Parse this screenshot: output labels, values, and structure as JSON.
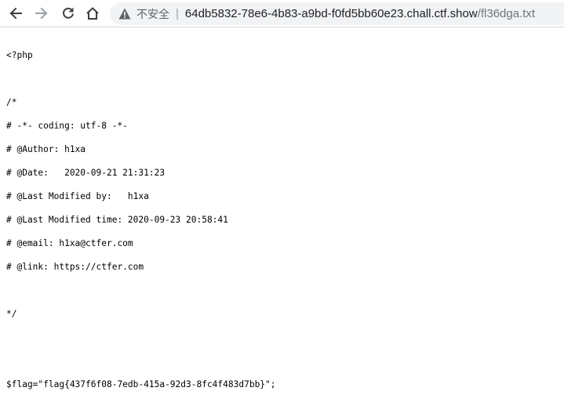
{
  "toolbar": {
    "back_icon": "arrow-left-icon",
    "forward_icon": "arrow-right-icon",
    "reload_icon": "reload-icon",
    "home_icon": "home-icon",
    "security_icon": "warning-triangle-icon",
    "security_label": "不安全",
    "url_host": "64db5832-78e6-4b83-a9bd-f0fd5bb60e23.chall.ctf.show",
    "url_path": "/fl36dga.txt"
  },
  "file": {
    "lines": [
      "<?php",
      "",
      "/*",
      "# -*- coding: utf-8 -*-",
      "# @Author: h1xa",
      "# @Date:   2020-09-21 21:31:23",
      "# @Last Modified by:   h1xa",
      "# @Last Modified time: 2020-09-23 20:58:41",
      "# @email: h1xa@ctfer.com",
      "# @link: https://ctfer.com",
      "",
      "*/",
      "",
      "",
      "$flag=\"flag{437f6f08-7edb-415a-92d3-8fc4f483d7bb}\";"
    ]
  },
  "colors": {
    "icon": "#3c4043",
    "icon_disabled": "#9aa0a6",
    "omnibox_bg": "#f1f3f4"
  }
}
